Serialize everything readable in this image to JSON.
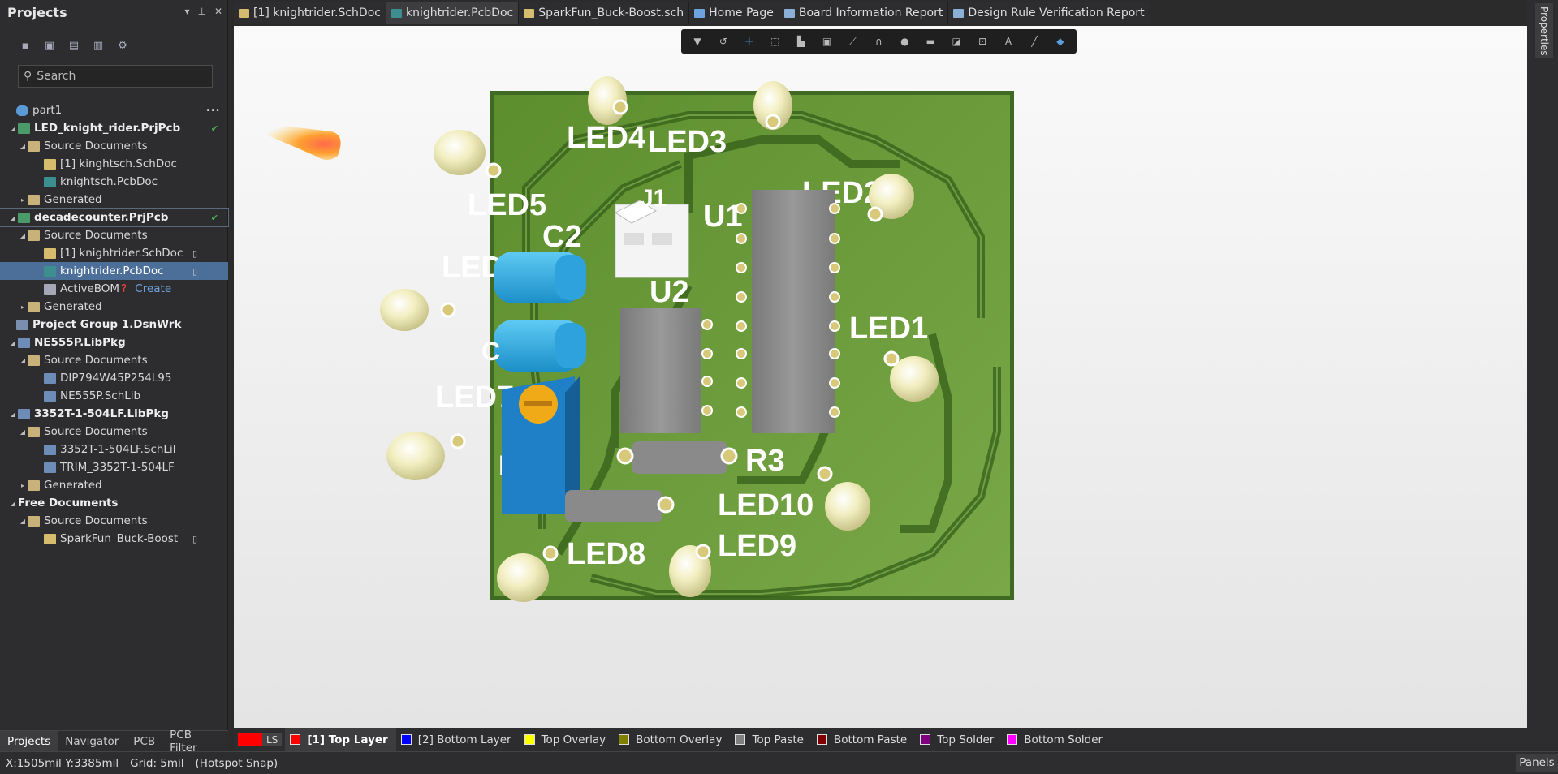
{
  "projects_panel": {
    "title": "Projects",
    "controls": [
      "▾",
      "⇲",
      "✕"
    ],
    "toolbar_icons": [
      "save-icon",
      "save-all-icon",
      "open-project-icon",
      "open-folder-icon",
      "settings-icon"
    ],
    "search_placeholder": "Search",
    "tree": [
      {
        "label": "part1",
        "icon": "cloud",
        "level": 0,
        "bold": false,
        "arrow": "",
        "extra": "•••"
      },
      {
        "label": "LED_knight_rider.PrjPcb",
        "icon": "prj",
        "level": 1,
        "bold": true,
        "arrow": "◢",
        "check": true
      },
      {
        "label": "Source Documents",
        "icon": "folder",
        "level": 2,
        "arrow": "◢"
      },
      {
        "label": "[1] kinghtsch.SchDoc",
        "icon": "sch",
        "level": 3
      },
      {
        "label": "knightsch.PcbDoc",
        "icon": "pcb",
        "level": 3
      },
      {
        "label": "Generated",
        "icon": "folder",
        "level": 2,
        "arrow": "▸"
      },
      {
        "label": "decadecounter.PrjPcb",
        "icon": "prj",
        "level": 1,
        "bold": true,
        "arrow": "◢",
        "check": true,
        "outlined": true
      },
      {
        "label": "Source Documents",
        "icon": "folder",
        "level": 2,
        "arrow": "◢"
      },
      {
        "label": "[1] knightrider.SchDoc",
        "icon": "sch",
        "level": 3,
        "doc": true
      },
      {
        "label": "knightrider.PcbDoc",
        "icon": "pcb",
        "level": 3,
        "doc": true,
        "selected": true
      },
      {
        "label": "ActiveBOM",
        "icon": "bom",
        "level": 3,
        "help": true,
        "create": "Create"
      },
      {
        "label": "Generated",
        "icon": "folder",
        "level": 2,
        "arrow": "▸"
      },
      {
        "label": "Project Group 1.DsnWrk",
        "icon": "grp",
        "level": 0,
        "bold": true
      },
      {
        "label": "NE555P.LibPkg",
        "icon": "lib",
        "level": 1,
        "bold": true,
        "arrow": "◢"
      },
      {
        "label": "Source Documents",
        "icon": "folder",
        "level": 2,
        "arrow": "◢"
      },
      {
        "label": "DIP794W45P254L95",
        "icon": "lib",
        "level": 3
      },
      {
        "label": "NE555P.SchLib",
        "icon": "lib",
        "level": 3
      },
      {
        "label": "3352T-1-504LF.LibPkg",
        "icon": "lib",
        "level": 1,
        "bold": true,
        "arrow": "◢"
      },
      {
        "label": "Source Documents",
        "icon": "folder",
        "level": 2,
        "arrow": "◢"
      },
      {
        "label": "3352T-1-504LF.SchLil",
        "icon": "lib",
        "level": 3
      },
      {
        "label": "TRIM_3352T-1-504LF",
        "icon": "lib",
        "level": 3
      },
      {
        "label": "Generated",
        "icon": "folder",
        "level": 2,
        "arrow": "▸"
      },
      {
        "label": "Free Documents",
        "icon": "",
        "level": 1,
        "bold": true,
        "arrow": "◢"
      },
      {
        "label": "Source Documents",
        "icon": "folder",
        "level": 2,
        "arrow": "◢"
      },
      {
        "label": "SparkFun_Buck-Boost",
        "icon": "sch",
        "level": 3,
        "doc": true
      }
    ],
    "bottom_tabs": [
      "Projects",
      "Navigator",
      "PCB",
      "PCB Filter"
    ],
    "active_bottom_tab": "Projects"
  },
  "doc_tabs": [
    {
      "label": "[1] knightrider.SchDoc",
      "icon": "sch"
    },
    {
      "label": "knightrider.PcbDoc",
      "icon": "pcb",
      "active": true
    },
    {
      "label": "SparkFun_Buck-Boost.sch",
      "icon": "sch"
    },
    {
      "label": "Home Page",
      "icon": "home"
    },
    {
      "label": "Board Information Report",
      "icon": "report"
    },
    {
      "label": "Design Rule Verification Report",
      "icon": "report"
    }
  ],
  "right_panel_tab": "Properties",
  "float_toolbar_icons": [
    "filter-icon",
    "route-icon",
    "cross-icon",
    "select-rect-icon",
    "align-icon",
    "component-icon",
    "track-icon",
    "arc-icon",
    "pin-icon",
    "fill-icon",
    "polygon-icon",
    "dim-icon",
    "text-icon",
    "line-icon",
    "3d-icon"
  ],
  "board": {
    "labels": [
      "LED4",
      "LED3",
      "LED2",
      "LED5",
      "U1",
      "C2",
      "LED",
      "U2",
      "LED1",
      "LED7",
      "R3",
      "LED10",
      "LED8",
      "LED9",
      "J1",
      "R",
      "C"
    ],
    "colors": {
      "board": "#6a9a3a",
      "edge": "#4d7a2a",
      "silk": "#ffffff",
      "pad": "#c8b86a",
      "led": "#f4f0c0",
      "ic": "#8c8c8c",
      "cap": "#2aa7e0",
      "pot": "#1e78c0",
      "pot_knob": "#e0a020",
      "header": "#f0f0f0"
    }
  },
  "layers": {
    "ls_label": "LS",
    "items": [
      {
        "label": "[1] Top Layer",
        "color": "#ff0000",
        "active": true
      },
      {
        "label": "[2] Bottom Layer",
        "color": "#0000ff"
      },
      {
        "label": "Top Overlay",
        "color": "#ffff00"
      },
      {
        "label": "Bottom Overlay",
        "color": "#808000"
      },
      {
        "label": "Top Paste",
        "color": "#808080"
      },
      {
        "label": "Bottom Paste",
        "color": "#800000"
      },
      {
        "label": "Top Solder",
        "color": "#800080"
      },
      {
        "label": "Bottom Solder",
        "color": "#ff00ff"
      }
    ]
  },
  "status": {
    "coords": "X:1505mil Y:3385mil",
    "grid": "Grid: 5mil",
    "snap": "(Hotspot Snap)",
    "panels": "Panels"
  }
}
